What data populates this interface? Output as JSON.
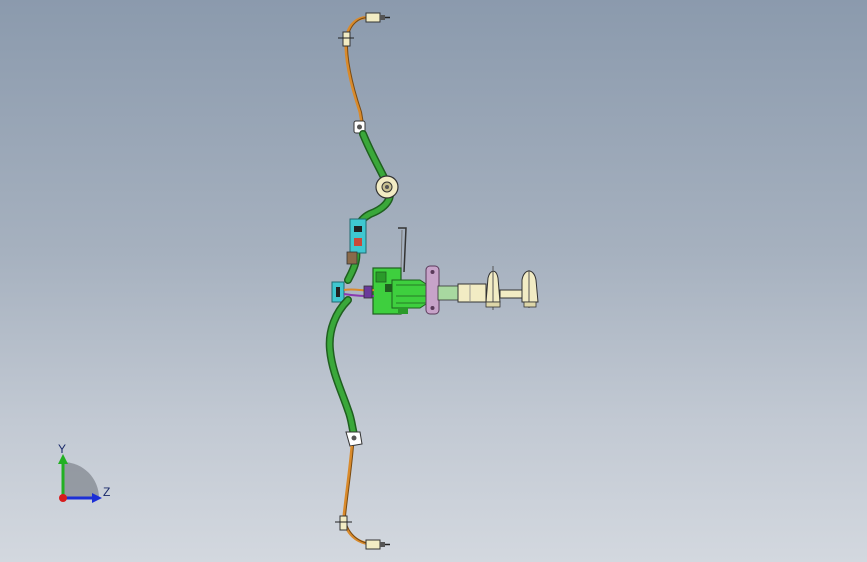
{
  "viewport": {
    "background_top": "#8b9aad",
    "background_bottom": "#d3d8df"
  },
  "model": {
    "parts": [
      {
        "name": "upper-connector",
        "icon": "connector-icon"
      },
      {
        "name": "upper-orange-cable",
        "icon": "cable-icon"
      },
      {
        "name": "upper-clip",
        "icon": "clip-icon"
      },
      {
        "name": "upper-green-conduit",
        "icon": "conduit-icon"
      },
      {
        "name": "round-grommet",
        "icon": "grommet-icon"
      },
      {
        "name": "cyan-bracket",
        "icon": "bracket-icon"
      },
      {
        "name": "central-green-housing",
        "icon": "housing-icon"
      },
      {
        "name": "pink-plate",
        "icon": "plate-icon"
      },
      {
        "name": "cream-connectors",
        "icon": "connector-icon"
      },
      {
        "name": "lower-green-conduit",
        "icon": "conduit-icon"
      },
      {
        "name": "lower-clip",
        "icon": "clip-icon"
      },
      {
        "name": "lower-orange-cable",
        "icon": "cable-icon"
      },
      {
        "name": "lower-connector",
        "icon": "connector-icon"
      }
    ],
    "colors": {
      "conduit_green": "#2e8b2e",
      "conduit_dark": "#1f5f1f",
      "cable_orange": "#d98a2b",
      "housing_green": "#3ecf3e",
      "bracket_cyan": "#3fc7d0",
      "plate_pink": "#c7a3c9",
      "connector_cream": "#f2ecc4"
    }
  },
  "triad": {
    "y_label": "Y",
    "z_label": "Z",
    "colors": {
      "y_axis": "#22b022",
      "z_axis": "#1c2fd6",
      "x_dot": "#d61c1c",
      "pie": "#8e949c"
    }
  }
}
